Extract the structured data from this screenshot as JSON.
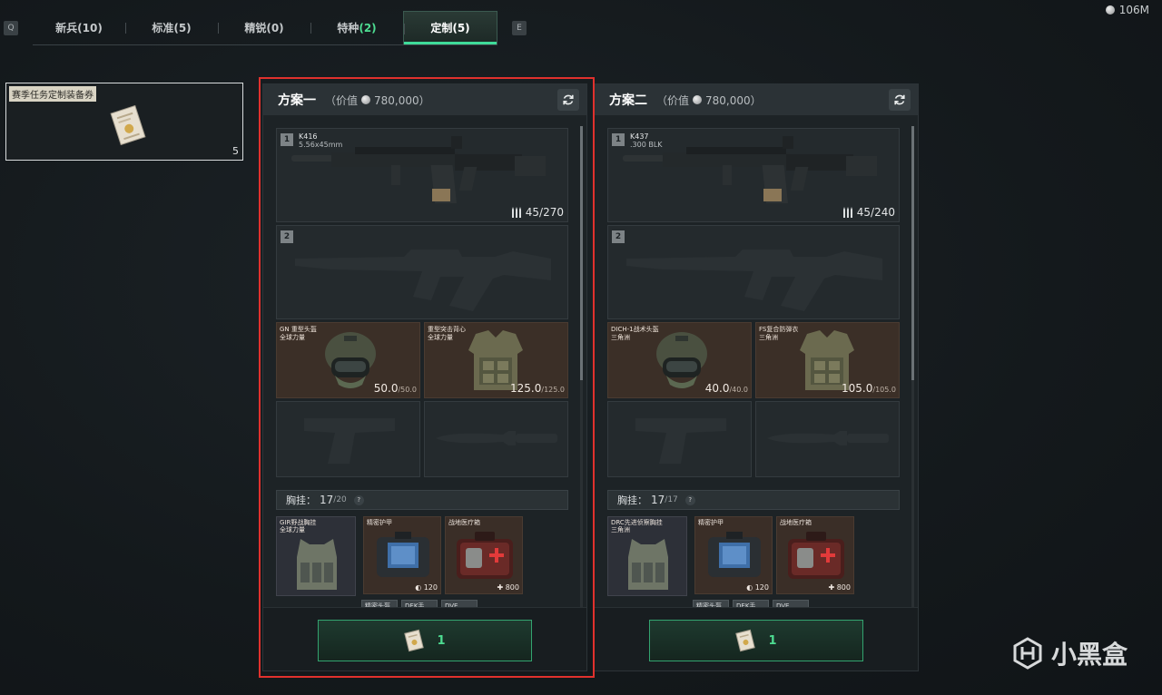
{
  "tabs": {
    "left_key": "Q",
    "right_key": "E",
    "items": [
      {
        "label": "新兵(10)"
      },
      {
        "label": "标准(5)"
      },
      {
        "label": "精锐(0)"
      },
      {
        "label_main": "特种",
        "label_count": "(2)"
      },
      {
        "label": "定制(5)"
      }
    ]
  },
  "currency": {
    "amount": "106M"
  },
  "coupon": {
    "label": "赛季任务定制装备券",
    "qty": "5"
  },
  "plans": [
    {
      "title": "方案一",
      "value_prefix": "（价值",
      "value": "780,000）",
      "primary": {
        "slot": "1",
        "name": "K416",
        "caliber": "5.56x45mm",
        "ammo": "45/270"
      },
      "secondary": {
        "slot": "2"
      },
      "helmet": {
        "name": "GN 重型头盔",
        "faction": "全球力量",
        "dur": "50.0",
        "max": "/50.0"
      },
      "armor": {
        "name": "重型突击背心",
        "faction": "全球力量",
        "dur": "125.0",
        "max": "/125.0"
      },
      "rig_bar": {
        "label": "胸挂：",
        "value": "17",
        "max": "/20",
        "help": "?"
      },
      "rig": {
        "name": "GIR野战胸挂",
        "faction": "全球力量"
      },
      "bag": {
        "name": "精密护甲",
        "value": "120"
      },
      "medkit": {
        "name": "战地医疗箱",
        "value": "800"
      },
      "chips": [
        "精密头盔",
        "DEK手...",
        "DVE..."
      ],
      "confirm_count": "1"
    },
    {
      "title": "方案二",
      "value_prefix": "（价值",
      "value": "780,000）",
      "primary": {
        "slot": "1",
        "name": "K437",
        "caliber": ".300 BLK",
        "ammo": "45/240"
      },
      "secondary": {
        "slot": "2"
      },
      "helmet": {
        "name": "DICH-1战术头盔",
        "faction": "三角洲",
        "dur": "40.0",
        "max": "/40.0"
      },
      "armor": {
        "name": "FS复合防弹衣",
        "faction": "三角洲",
        "dur": "105.0",
        "max": "/105.0"
      },
      "rig_bar": {
        "label": "胸挂：",
        "value": "17",
        "max": "/17",
        "help": "?"
      },
      "rig": {
        "name": "DRC先进侦察胸挂",
        "faction": "三角洲"
      },
      "bag": {
        "name": "精密护甲",
        "value": "120"
      },
      "medkit": {
        "name": "战地医疗箱",
        "value": "800"
      },
      "chips": [
        "精密头盔",
        "DEK手...",
        "DVE..."
      ],
      "confirm_count": "1"
    }
  ],
  "watermark": {
    "text": "小黑盒"
  },
  "colors": {
    "accent": "#4ddc91",
    "selection": "#e0312d",
    "gear_bg": "#3b2f27"
  }
}
